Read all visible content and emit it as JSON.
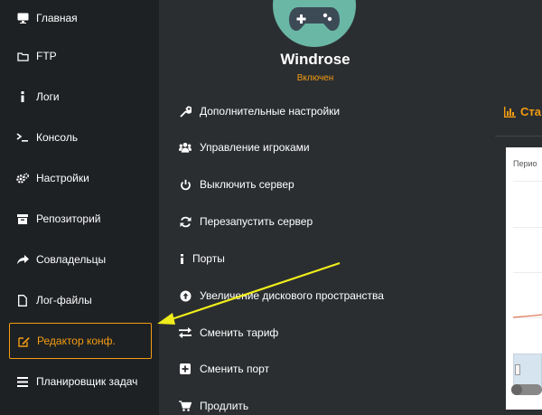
{
  "sidebar": {
    "items": [
      {
        "label": "Главная",
        "icon": "monitor-icon"
      },
      {
        "label": "FTP",
        "icon": "folder-icon"
      },
      {
        "label": "Логи",
        "icon": "info-icon"
      },
      {
        "label": "Консоль",
        "icon": "terminal-icon"
      },
      {
        "label": "Настройки",
        "icon": "gears-icon"
      },
      {
        "label": "Репозиторий",
        "icon": "archive-icon"
      },
      {
        "label": "Совладельцы",
        "icon": "share-icon"
      },
      {
        "label": "Лог-файлы",
        "icon": "file-icon"
      },
      {
        "label": "Редактор конф.",
        "icon": "edit-icon",
        "active": true
      },
      {
        "label": "Планировщик задач",
        "icon": "list-icon"
      }
    ]
  },
  "server": {
    "name": "Windrose",
    "status": "Включен",
    "avatar_icon": "gamepad-icon"
  },
  "actions": [
    {
      "label": "Дополнительные настройки",
      "icon": "wrench-icon"
    },
    {
      "label": "Управление игроками",
      "icon": "users-icon"
    },
    {
      "label": "Выключить сервер",
      "icon": "power-icon"
    },
    {
      "label": "Перезапустить сервер",
      "icon": "refresh-icon"
    },
    {
      "label": "Порты",
      "icon": "info-icon"
    },
    {
      "label": "Увеличение дискового пространства",
      "icon": "arrow-up-circle-icon"
    },
    {
      "label": "Сменить тариф",
      "icon": "exchange-icon"
    },
    {
      "label": "Сменить порт",
      "icon": "plus-square-icon"
    },
    {
      "label": "Продлить",
      "icon": "cart-icon"
    }
  ],
  "stats": {
    "title": "Ста",
    "period_label": "Перио"
  },
  "colors": {
    "accent": "#f39c12",
    "sidebar_bg": "#1e2124",
    "main_bg": "#2b2e31",
    "avatar_bg": "#6ab7a5",
    "annotation_arrow": "#f0ec1c"
  }
}
